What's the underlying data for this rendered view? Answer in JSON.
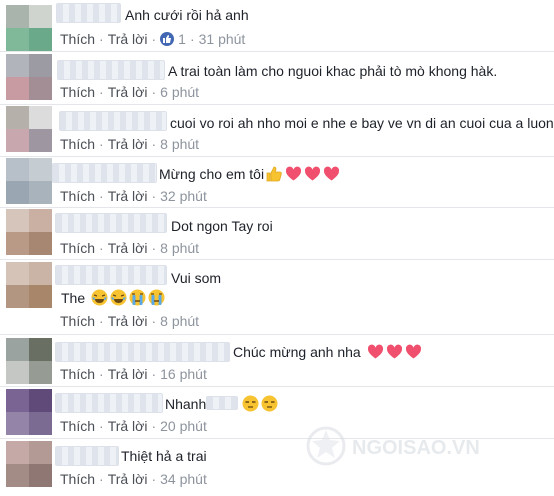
{
  "labels": {
    "like": "Thích",
    "reply": "Trả lời",
    "sep": "·"
  },
  "comments": [
    {
      "text": "Anh cưới rồi hả anh",
      "reactions": "1",
      "time": "31 phút",
      "emoji": []
    },
    {
      "text": "A trai toàn làm cho nguoi khac phải tò mò khong hàk.",
      "time": "6 phút",
      "emoji": []
    },
    {
      "text": "cuoi vo roi ah nho moi e nhe e bay ve vn di an cuoi cua a luon",
      "time": "8 phút",
      "emoji": []
    },
    {
      "text": "Mừng cho em tôi",
      "time": "32 phút",
      "emoji": [
        "thumbs-up-emoji",
        "heart-emoji",
        "heart-emoji",
        "heart-emoji"
      ]
    },
    {
      "text": "Dot ngon Tay roi",
      "time": "8 phút",
      "emoji": []
    },
    {
      "text": "Vui som",
      "text2": "The",
      "time": "8 phút",
      "emoji": [
        "laugh-cry-emoji",
        "laugh-cry-emoji",
        "crying-emoji",
        "crying-emoji"
      ]
    },
    {
      "text": "Chúc mừng anh nha",
      "time": "16 phút",
      "emoji": [
        "heart-emoji",
        "heart-emoji",
        "heart-emoji"
      ]
    },
    {
      "text": "Nhanh",
      "time": "20 phút",
      "emoji": [
        "unamused-emoji",
        "unamused-emoji"
      ]
    },
    {
      "text": "Thiệt hả a trai",
      "time": "34 phút",
      "emoji": []
    }
  ],
  "watermark": "NGOISAO.VN",
  "colors": {
    "heart": "#f0506e",
    "link": "#4b4f56",
    "like_badge": "#4267b2"
  }
}
